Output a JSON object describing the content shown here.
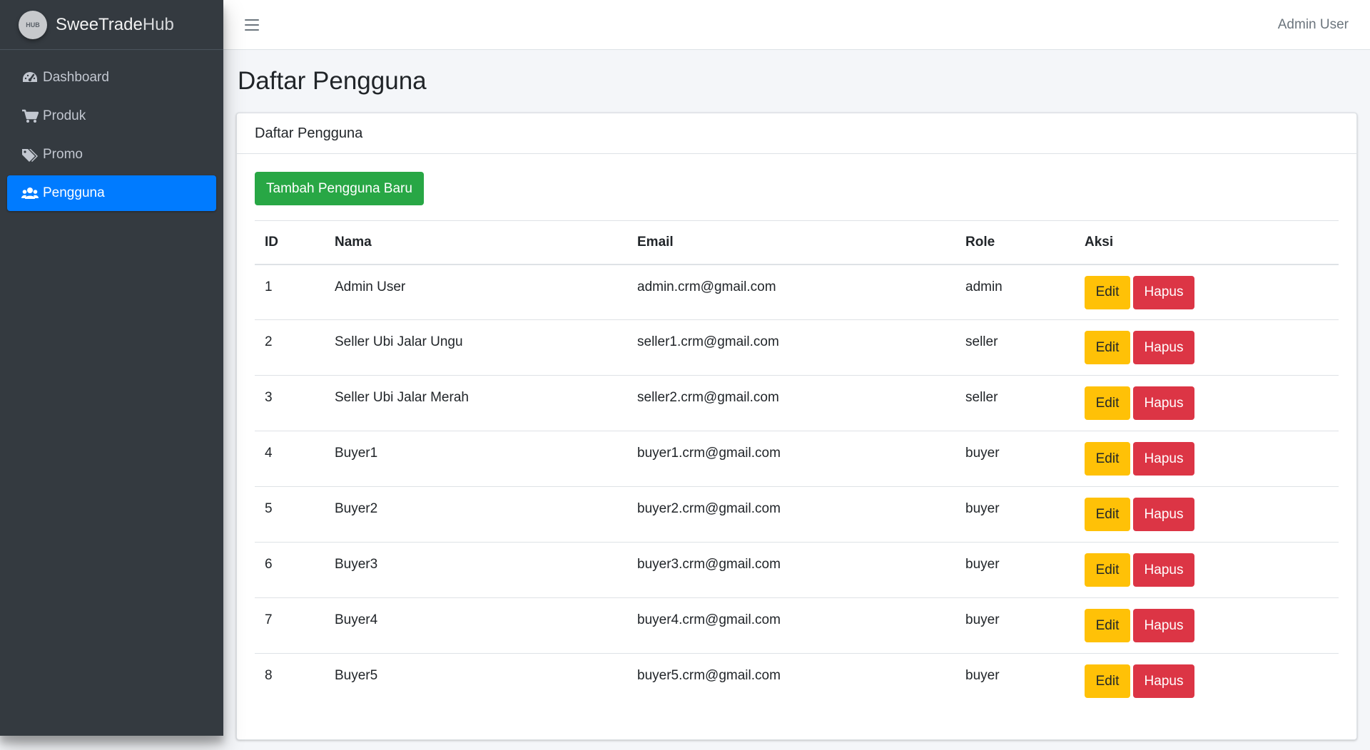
{
  "brand": {
    "name_bold": "SweeTrade",
    "name_light": "Hub",
    "logo_text": "HUB"
  },
  "sidebar": {
    "items": [
      {
        "label": "Dashboard",
        "icon": "gauge-icon",
        "active": false
      },
      {
        "label": "Produk",
        "icon": "cart-icon",
        "active": false
      },
      {
        "label": "Promo",
        "icon": "tags-icon",
        "active": false
      },
      {
        "label": "Pengguna",
        "icon": "users-icon",
        "active": true
      }
    ]
  },
  "topbar": {
    "user": "Admin User"
  },
  "page": {
    "title": "Daftar Pengguna"
  },
  "card": {
    "title": "Daftar Pengguna",
    "add_button": "Tambah Pengguna Baru"
  },
  "table": {
    "headers": {
      "id": "ID",
      "nama": "Nama",
      "email": "Email",
      "role": "Role",
      "aksi": "Aksi"
    },
    "edit_label": "Edit",
    "delete_label": "Hapus",
    "rows": [
      {
        "id": "1",
        "nama": "Admin User",
        "email": "admin.crm@gmail.com",
        "role": "admin"
      },
      {
        "id": "2",
        "nama": "Seller Ubi Jalar Ungu",
        "email": "seller1.crm@gmail.com",
        "role": "seller"
      },
      {
        "id": "3",
        "nama": "Seller Ubi Jalar Merah",
        "email": "seller2.crm@gmail.com",
        "role": "seller"
      },
      {
        "id": "4",
        "nama": "Buyer1",
        "email": "buyer1.crm@gmail.com",
        "role": "buyer"
      },
      {
        "id": "5",
        "nama": "Buyer2",
        "email": "buyer2.crm@gmail.com",
        "role": "buyer"
      },
      {
        "id": "6",
        "nama": "Buyer3",
        "email": "buyer3.crm@gmail.com",
        "role": "buyer"
      },
      {
        "id": "7",
        "nama": "Buyer4",
        "email": "buyer4.crm@gmail.com",
        "role": "buyer"
      },
      {
        "id": "8",
        "nama": "Buyer5",
        "email": "buyer5.crm@gmail.com",
        "role": "buyer"
      }
    ]
  },
  "colors": {
    "sidebar_bg": "#343a40",
    "active_nav": "#007bff",
    "success": "#28a745",
    "warning": "#ffc107",
    "danger": "#dc3545"
  }
}
